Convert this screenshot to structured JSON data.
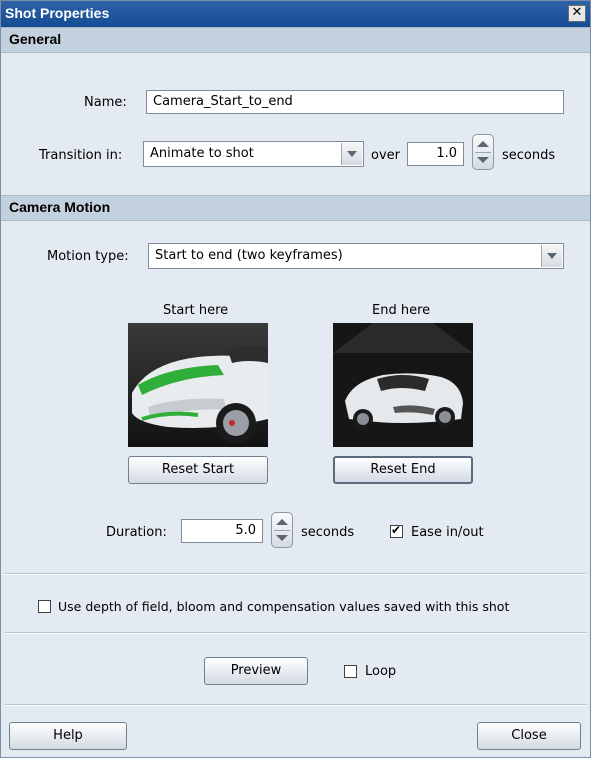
{
  "window": {
    "title": "Shot Properties",
    "close_glyph": "✕"
  },
  "general": {
    "section_title": "General",
    "name_label": "Name:",
    "name_value": "Camera_Start_to_end",
    "transition_label": "Transition in:",
    "transition_value": "Animate to shot",
    "over_label": "over",
    "over_value": "1.0",
    "seconds_label": "seconds"
  },
  "camera_motion": {
    "section_title": "Camera Motion",
    "motion_type_label": "Motion type:",
    "motion_type_value": "Start to end (two keyframes)",
    "start_caption": "Start here",
    "end_caption": "End here",
    "reset_start_label": "Reset Start",
    "reset_end_label": "Reset End",
    "duration_label": "Duration:",
    "duration_value": "5.0",
    "seconds_label": "seconds",
    "ease_label": "Ease in/out",
    "ease_checked": true
  },
  "options": {
    "dof_label": "Use depth of field, bloom and compensation values saved with this shot",
    "dof_checked": false,
    "preview_label": "Preview",
    "loop_label": "Loop",
    "loop_checked": false
  },
  "footer": {
    "help_label": "Help",
    "close_label": "Close"
  },
  "colors": {
    "titlebar": "#1c549e",
    "section_header": "#c3d0dd",
    "dialog_bg": "#e4eaf1"
  }
}
